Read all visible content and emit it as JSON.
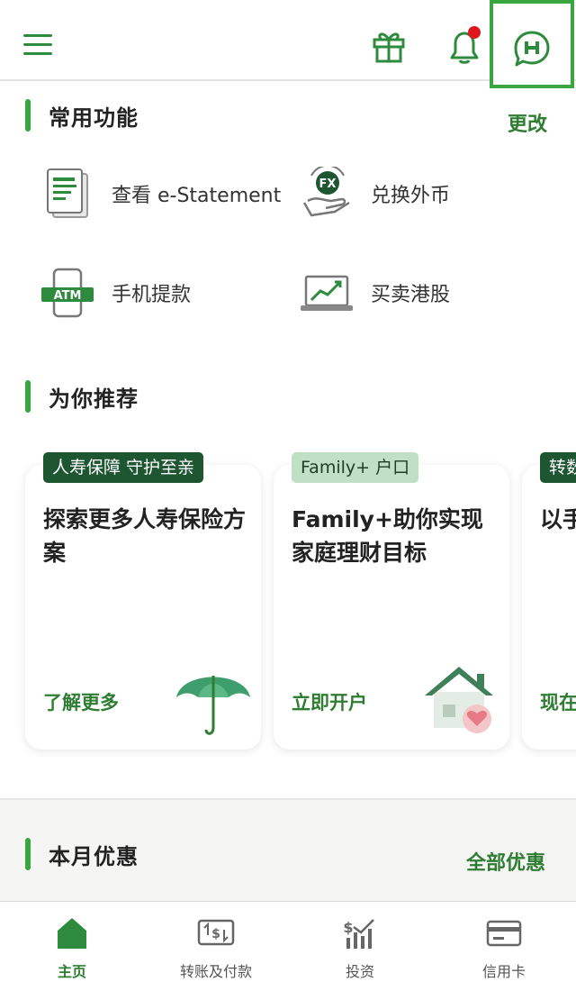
{
  "header": {
    "menu_icon": "hamburger-menu-icon",
    "gift_icon": "gift-icon",
    "bell_icon": "bell-icon",
    "chat_icon": "chat-bubble-icon",
    "notification_dot_color": "#e0161e",
    "accent_color": "#3aa640"
  },
  "frequent": {
    "title": "常用功能",
    "edit_label": "更改",
    "items": [
      {
        "label": "查看 e-Statement",
        "icon": "statement-icon"
      },
      {
        "label": "兑换外币",
        "icon": "fx-exchange-icon"
      },
      {
        "label": "手机提款",
        "icon": "atm-mobile-icon"
      },
      {
        "label": "买卖港股",
        "icon": "stock-chart-icon"
      }
    ]
  },
  "recommend": {
    "title": "为你推荐",
    "cards": [
      {
        "tag": "人寿保障 守护至亲",
        "title": "探索更多人寿保险方案",
        "cta": "了解更多",
        "art": "umbrella-icon"
      },
      {
        "tag": "Family+ 户口",
        "title": "Family+助你实现家庭理财目标",
        "cta": "立即开户",
        "art": "house-heart-icon"
      },
      {
        "tag": "转数",
        "title": "以手定\"款钅",
        "cta": "现在",
        "art": ""
      }
    ]
  },
  "offers": {
    "title": "本月优惠",
    "all_label": "全部优惠"
  },
  "bottom_nav": {
    "items": [
      {
        "label": "主页",
        "icon": "home-icon",
        "active": true
      },
      {
        "label": "转账及付款",
        "icon": "transfer-icon",
        "active": false
      },
      {
        "label": "投资",
        "icon": "investment-icon",
        "active": false
      },
      {
        "label": "信用卡",
        "icon": "credit-card-icon",
        "active": false
      }
    ]
  }
}
